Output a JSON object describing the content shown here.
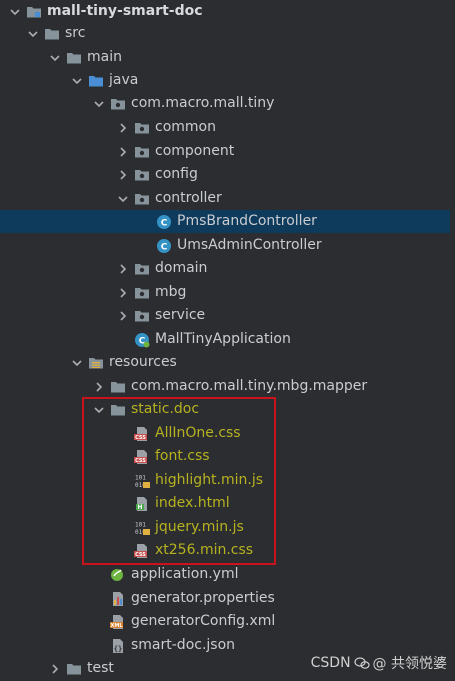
{
  "tree": [
    {
      "label": "mall-tiny-smart-doc",
      "icon": "project-folder-icon",
      "arrow": "down",
      "kind": "root"
    },
    {
      "label": "src",
      "icon": "folder-icon",
      "arrow": "down"
    },
    {
      "label": "main",
      "icon": "folder-icon",
      "arrow": "down"
    },
    {
      "label": "java",
      "icon": "source-folder-icon",
      "arrow": "down"
    },
    {
      "label": "com.macro.mall.tiny",
      "icon": "package-icon",
      "arrow": "down"
    },
    {
      "label": "common",
      "icon": "package-icon",
      "arrow": "right"
    },
    {
      "label": "component",
      "icon": "package-icon",
      "arrow": "right"
    },
    {
      "label": "config",
      "icon": "package-icon",
      "arrow": "right"
    },
    {
      "label": "controller",
      "icon": "package-icon",
      "arrow": "down"
    },
    {
      "label": "PmsBrandController",
      "icon": "class-icon",
      "arrow": "none",
      "selected": true
    },
    {
      "label": "UmsAdminController",
      "icon": "class-icon",
      "arrow": "none"
    },
    {
      "label": "domain",
      "icon": "package-icon",
      "arrow": "right"
    },
    {
      "label": "mbg",
      "icon": "package-icon",
      "arrow": "right"
    },
    {
      "label": "service",
      "icon": "package-icon",
      "arrow": "right"
    },
    {
      "label": "MallTinyApplication",
      "icon": "spring-class-icon",
      "arrow": "none"
    },
    {
      "label": "resources",
      "icon": "resources-folder-icon",
      "arrow": "down"
    },
    {
      "label": "com.macro.mall.tiny.mbg.mapper",
      "icon": "folder-icon",
      "arrow": "right"
    },
    {
      "label": "static.doc",
      "icon": "folder-icon",
      "arrow": "down",
      "kind": "yellow"
    },
    {
      "label": "AllInOne.css",
      "icon": "css-file-icon",
      "arrow": "none",
      "kind": "yellow"
    },
    {
      "label": "font.css",
      "icon": "css-file-icon",
      "arrow": "none",
      "kind": "yellow"
    },
    {
      "label": "highlight.min.js",
      "icon": "js-file-icon",
      "arrow": "none",
      "kind": "yellow"
    },
    {
      "label": "index.html",
      "icon": "html-file-icon",
      "arrow": "none",
      "kind": "yellow"
    },
    {
      "label": "jquery.min.js",
      "icon": "js-file-icon",
      "arrow": "none",
      "kind": "yellow"
    },
    {
      "label": "xt256.min.css",
      "icon": "css-file-icon",
      "arrow": "none",
      "kind": "yellow"
    },
    {
      "label": "application.yml",
      "icon": "spring-yml-icon",
      "arrow": "none"
    },
    {
      "label": "generator.properties",
      "icon": "properties-file-icon",
      "arrow": "none"
    },
    {
      "label": "generatorConfig.xml",
      "icon": "xml-file-icon",
      "arrow": "none"
    },
    {
      "label": "smart-doc.json",
      "icon": "json-file-icon",
      "arrow": "none"
    },
    {
      "label": "test",
      "icon": "folder-icon",
      "arrow": "right"
    }
  ],
  "watermark": {
    "text": "CSDN",
    "author": "@ 共领悦婆"
  },
  "colors": {
    "background": "#2b2d30",
    "selection": "#0e3a5c",
    "highlight_box": "#c8141a",
    "excluded_text": "#b7b21f"
  }
}
